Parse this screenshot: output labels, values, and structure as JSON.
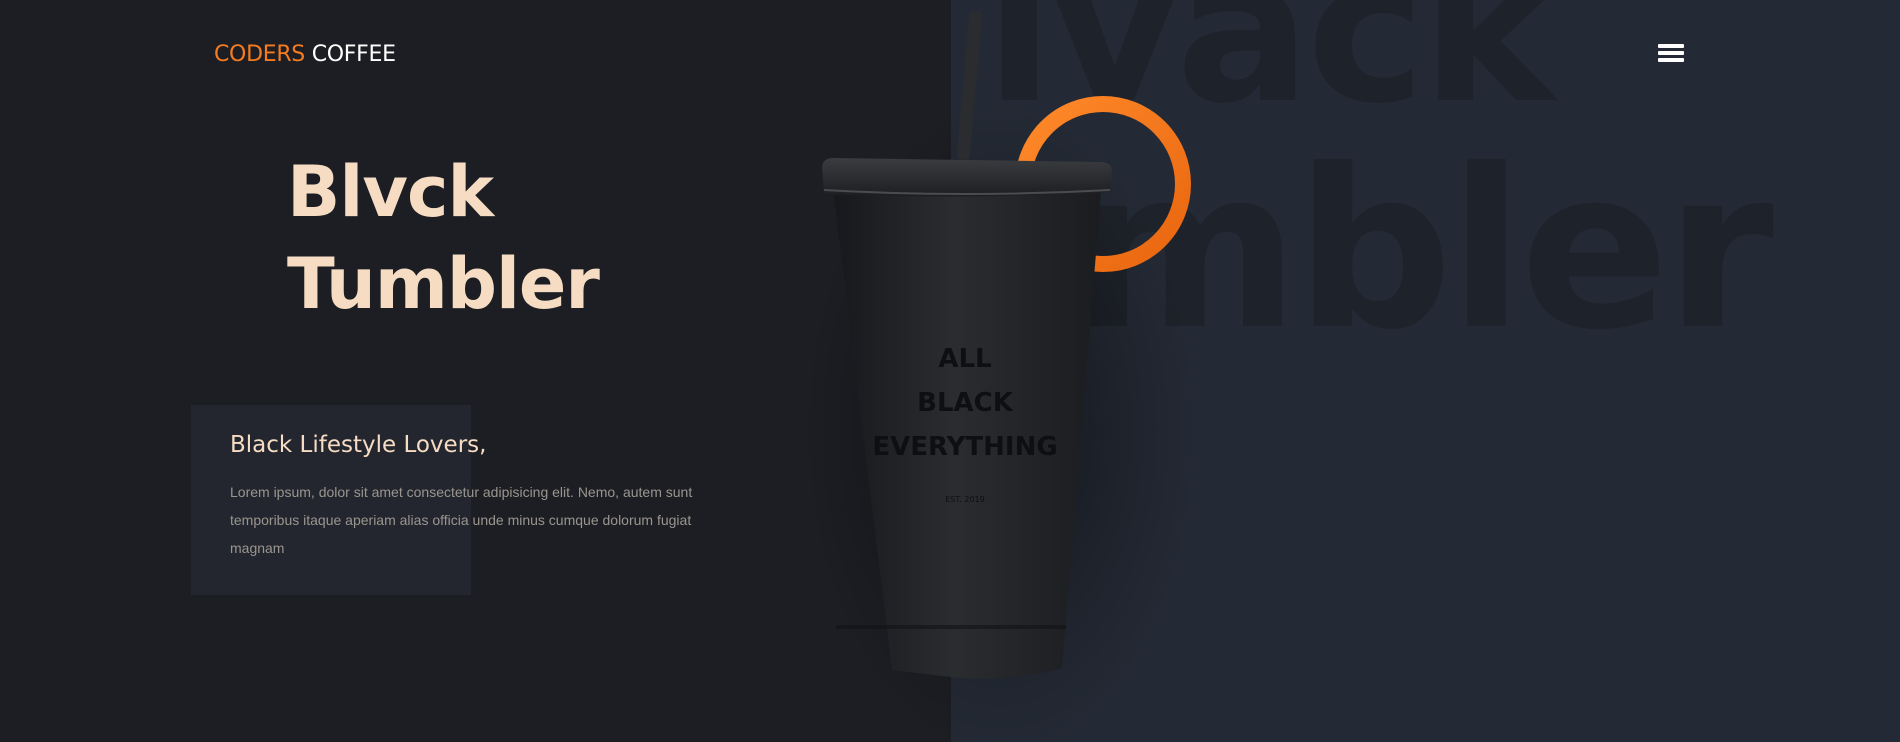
{
  "header": {
    "logo_part_1": "CODERS",
    "logo_part_2": "COFFEE",
    "menu_icon": "hamburger-menu-icon"
  },
  "hero": {
    "title_line_1": "Blvck",
    "title_line_2": "Tumbler",
    "background_word_1": "lvack",
    "background_word_2": "mbler"
  },
  "info": {
    "heading": "Black Lifestyle Lovers,",
    "body": "Lorem ipsum, dolor sit amet consectetur adipisicing elit. Nemo, autem sunt temporibus itaque aperiam alias officia unde minus cumque dolorum fugiat magnam"
  },
  "product": {
    "print_line_1": "ALL",
    "print_line_2": "BLACK",
    "print_line_3": "EVERYTHING",
    "print_small": "EST. 2019"
  },
  "colors": {
    "accent": "#f47b1f",
    "title": "#f5dcc3",
    "background_left": "#1c1e23",
    "background_right": "#242a35"
  }
}
